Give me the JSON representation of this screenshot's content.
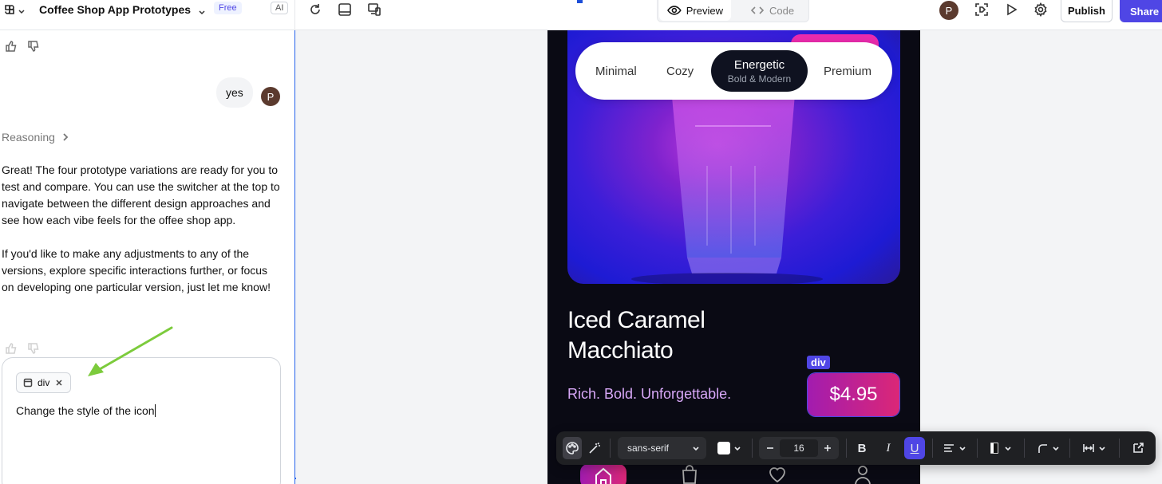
{
  "app": {
    "project_title": "Coffee Shop App Prototypes",
    "plan_badge": "Free",
    "ai_badge": "AI",
    "mode": {
      "preview_label": "Preview",
      "code_label": "Code"
    },
    "user_initial": "P",
    "publish_label": "Publish",
    "share_label": "Share",
    "accent": "#4f46e5"
  },
  "chat": {
    "user_message": "yes",
    "user_initial": "P",
    "reasoning_label": "Reasoning",
    "assistant_paragraphs": [
      "Great! The four prototype variations are ready for you to test and compare. You can use the switcher at the top to navigate between the different design approaches and see how each vibe feels for the offee shop app.",
      "If you'd like to make any adjustments to any of the versions, explore specific interactions further, or focus on developing one particular version, just let me know!"
    ],
    "composer": {
      "chip_label": "div",
      "input_text": "Change the style of the icon"
    }
  },
  "preview": {
    "switcher": {
      "items": [
        "Minimal",
        "Cozy",
        "Energetic",
        "Premium"
      ],
      "active": "Energetic",
      "active_sub": "Bold & Modern"
    },
    "product": {
      "title_line1": "Iced Caramel",
      "title_line2": "Macchiato",
      "tagline": "Rich. Bold. Unforgettable.",
      "price": "$4.95",
      "selected_tag": "div"
    }
  },
  "toolbar": {
    "font_family": "sans-serif",
    "font_size": "16",
    "bold_label": "B",
    "italic_label": "I",
    "underline_label": "U"
  }
}
